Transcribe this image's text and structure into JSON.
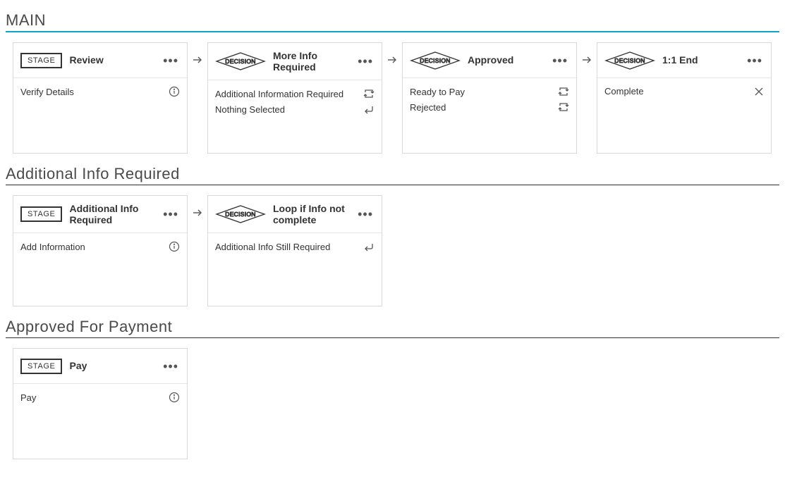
{
  "sections": [
    {
      "title": "MAIN",
      "primary": true,
      "cards": [
        {
          "type": "STAGE",
          "title": "Review",
          "items": [
            {
              "label": "Verify Details",
              "icon": "info"
            }
          ]
        },
        {
          "type": "DECISION",
          "title": "More Info Required",
          "items": [
            {
              "label": "Additional Information Required",
              "icon": "loop"
            },
            {
              "label": "Nothing Selected",
              "icon": "back"
            }
          ]
        },
        {
          "type": "DECISION",
          "title": "Approved",
          "items": [
            {
              "label": "Ready to Pay",
              "icon": "loop"
            },
            {
              "label": "Rejected",
              "icon": "loop"
            }
          ]
        },
        {
          "type": "DECISION",
          "title": "1:1 End",
          "items": [
            {
              "label": "Complete",
              "icon": "x"
            }
          ]
        }
      ]
    },
    {
      "title": "Additional Info Required",
      "primary": false,
      "cards": [
        {
          "type": "STAGE",
          "title": "Additional Info Required",
          "items": [
            {
              "label": "Add Information",
              "icon": "info"
            }
          ]
        },
        {
          "type": "DECISION",
          "title": "Loop if Info not complete",
          "items": [
            {
              "label": "Additional Info Still Required",
              "icon": "back"
            }
          ]
        }
      ]
    },
    {
      "title": "Approved For Payment",
      "primary": false,
      "cards": [
        {
          "type": "STAGE",
          "title": "Pay",
          "items": [
            {
              "label": "Pay",
              "icon": "info"
            }
          ]
        }
      ]
    }
  ],
  "badge_labels": {
    "stage": "STAGE",
    "decision": "DECISION"
  }
}
